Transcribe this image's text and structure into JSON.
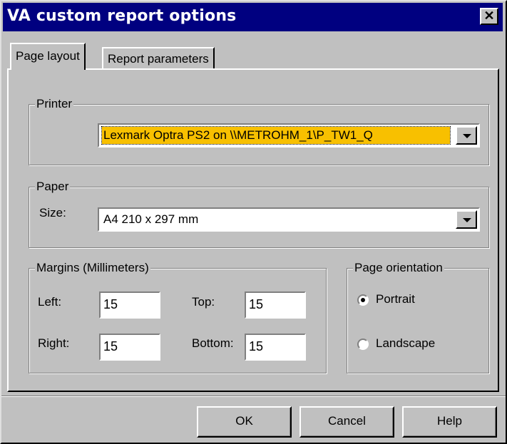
{
  "window": {
    "title": "VA custom report options",
    "close_glyph": "✕"
  },
  "tabs": [
    {
      "label": "Page layout",
      "active": true
    },
    {
      "label": "Report parameters",
      "active": false
    }
  ],
  "printer": {
    "group_label": "Printer",
    "selected": "Lexmark Optra PS2 on \\\\METROHM_1\\P_TW1_Q"
  },
  "paper": {
    "group_label": "Paper",
    "size_label": "Size:",
    "size_value": "A4 210 x 297 mm"
  },
  "margins": {
    "group_label": "Margins (Millimeters)",
    "left_label": "Left:",
    "left_value": "15",
    "top_label": "Top:",
    "top_value": "15",
    "right_label": "Right:",
    "right_value": "15",
    "bottom_label": "Bottom:",
    "bottom_value": "15"
  },
  "orientation": {
    "group_label": "Page orientation",
    "options": [
      {
        "label": "Portrait",
        "selected": true
      },
      {
        "label": "Landscape",
        "selected": false
      }
    ]
  },
  "buttons": {
    "ok": "OK",
    "cancel": "Cancel",
    "help": "Help"
  },
  "colors": {
    "titlebar": "#000080",
    "face": "#c0c0c0",
    "selection": "#f8c000"
  },
  "icons": {
    "close": "close-icon",
    "dropdown": "chevron-down-icon",
    "radio": "radio-icon"
  }
}
